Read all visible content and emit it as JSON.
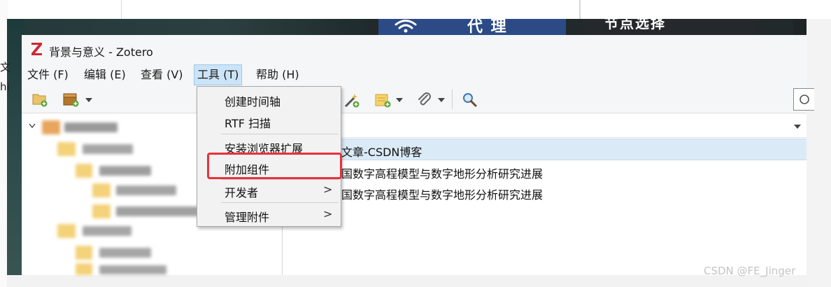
{
  "window": {
    "title": "背景与意义 - Zotero",
    "logo_letter": "Z"
  },
  "background": {
    "panel_text_1": "代 理",
    "panel_text_2": "节点选择",
    "side_text_1": "文",
    "side_text_2": "hi"
  },
  "menu": {
    "items": [
      {
        "label": "文件 (F)"
      },
      {
        "label": "编辑 (E)"
      },
      {
        "label": "查看 (V)"
      },
      {
        "label": "工具 (T)"
      },
      {
        "label": "帮助 (H)"
      }
    ]
  },
  "tools_menu": {
    "items": [
      {
        "label": "创建时间轴",
        "submenu": false
      },
      {
        "label": "RTF 扫描",
        "submenu": false
      },
      {
        "label": "安装浏览器扩展",
        "submenu": false
      },
      {
        "label": "附加组件",
        "submenu": false
      },
      {
        "label": "开发者",
        "submenu": true
      },
      {
        "label": "管理附件",
        "submenu": true
      }
    ],
    "submenu_arrow": ">"
  },
  "items_list": {
    "rows": [
      {
        "title": "文章-CSDN博客",
        "selected": true
      },
      {
        "title": "国数字高程模型与数字地形分析研究进展",
        "selected": false
      },
      {
        "title": "国数字高程模型与数字地形分析研究进展",
        "selected": false
      }
    ]
  },
  "watermark": "CSDN @FE_Jinger",
  "colors": {
    "highlight": "#e8313b",
    "selected_row": "#dbeaf7",
    "menu_active": "#cce4f7"
  }
}
